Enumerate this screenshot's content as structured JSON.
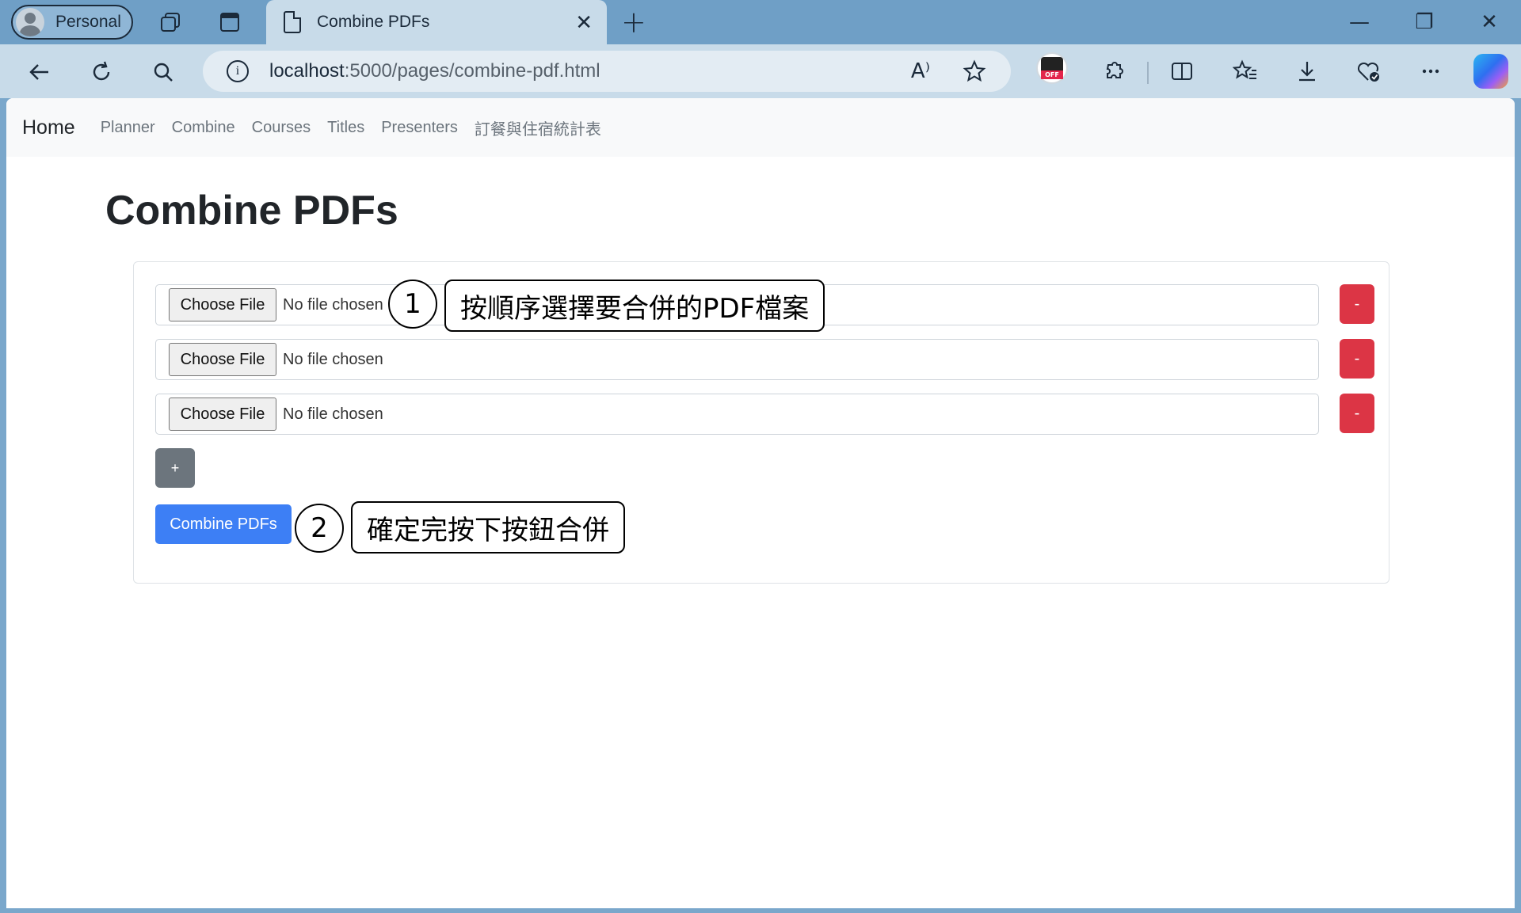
{
  "browser": {
    "profile_label": "Personal",
    "tab_title": "Combine PDFs",
    "tab_close": "✕",
    "new_tab": "+",
    "url_host": "localhost",
    "url_path": ":5000/pages/combine-pdf.html",
    "info_icon": "i",
    "read_aloud_icon": "A⁾",
    "window_minimize": "—",
    "window_restore": "❐",
    "window_close": "✕"
  },
  "navbar": {
    "brand": "Home",
    "links": [
      "Planner",
      "Combine",
      "Courses",
      "Titles",
      "Presenters",
      "訂餐與住宿統計表"
    ]
  },
  "page": {
    "title": "Combine PDFs",
    "file_rows": [
      {
        "button": "Choose File",
        "status": "No file chosen"
      },
      {
        "button": "Choose File",
        "status": "No file chosen"
      },
      {
        "button": "Choose File",
        "status": "No file chosen"
      }
    ],
    "remove_label": "-",
    "add_label": "+",
    "combine_label": "Combine PDFs"
  },
  "annotations": [
    {
      "number": "1",
      "text": "按順序選擇要合併的PDF檔案"
    },
    {
      "number": "2",
      "text": "確定完按下按鈕合併"
    }
  ]
}
